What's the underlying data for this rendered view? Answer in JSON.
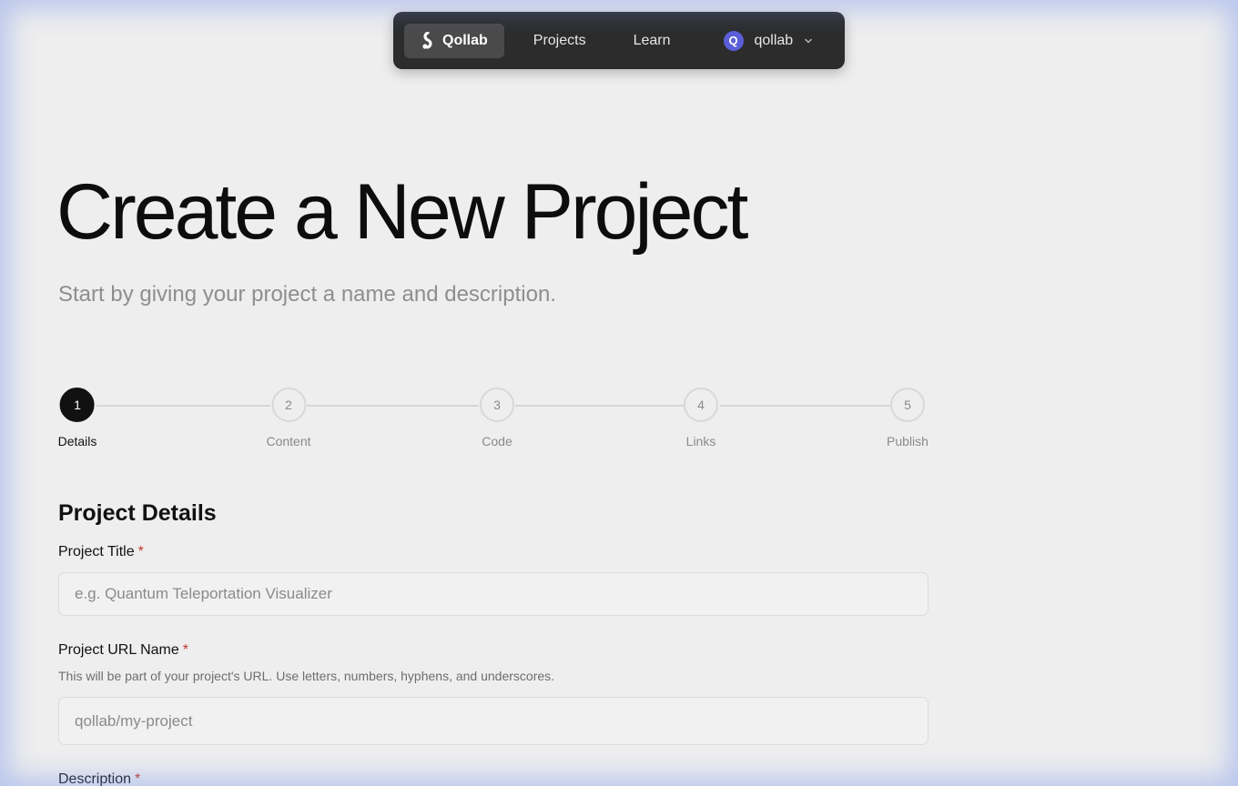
{
  "nav": {
    "brand_label": "Qollab",
    "projects_label": "Projects",
    "learn_label": "Learn",
    "user": {
      "avatar_letter": "Q",
      "username": "qollab"
    }
  },
  "page": {
    "title": "Create a New Project",
    "subtitle": "Start by giving your project a name and description."
  },
  "stepper": {
    "active_index": 0,
    "steps": [
      {
        "number": "1",
        "label": "Details"
      },
      {
        "number": "2",
        "label": "Content"
      },
      {
        "number": "3",
        "label": "Code"
      },
      {
        "number": "4",
        "label": "Links"
      },
      {
        "number": "5",
        "label": "Publish"
      }
    ]
  },
  "form": {
    "section_title": "Project Details",
    "required_marker": "*",
    "title_field": {
      "label": "Project Title",
      "placeholder": "e.g. Quantum Teleportation Visualizer",
      "value": ""
    },
    "url_field": {
      "label": "Project URL Name",
      "help": "This will be part of your project's URL. Use letters, numbers, hyphens, and underscores.",
      "placeholder": "qollab/my-project",
      "value": ""
    },
    "description_field": {
      "label": "Description"
    }
  },
  "colors": {
    "background": "#eeeeee",
    "nav_background": "#2c2c2c",
    "avatar": "#5a5fd8",
    "required": "#c0392b",
    "active_step": "#111111"
  }
}
